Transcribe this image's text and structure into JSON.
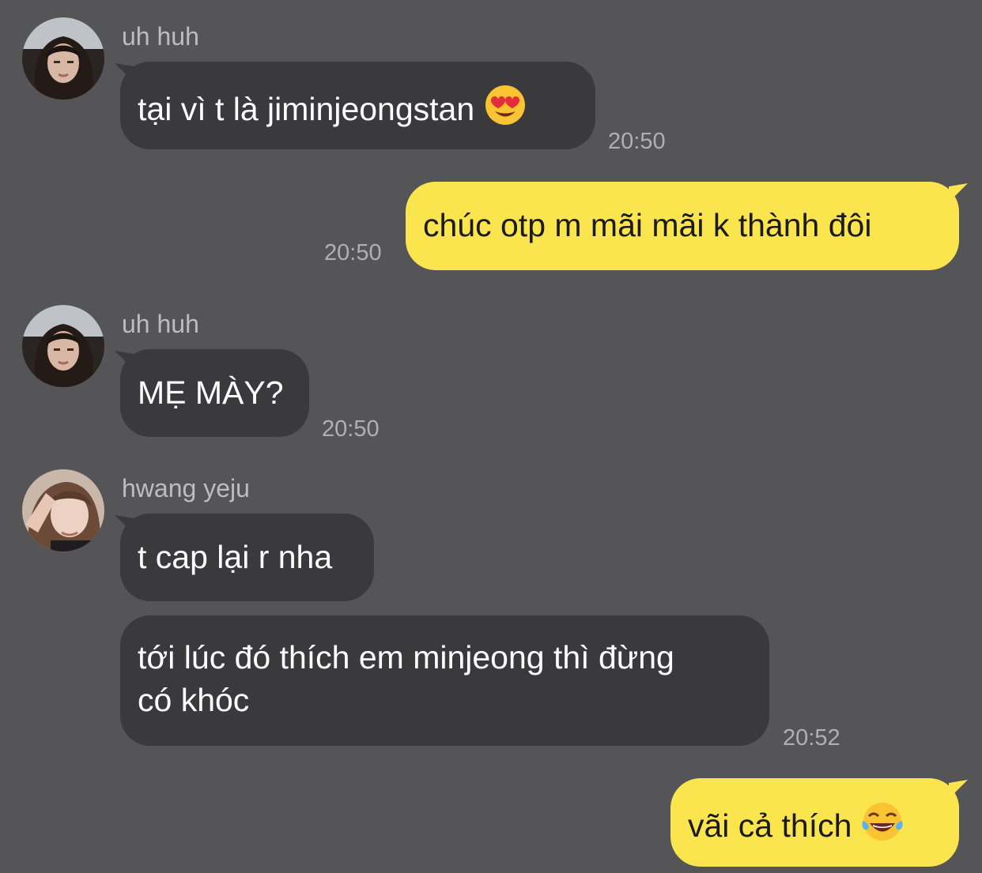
{
  "messages": [
    {
      "sender": "uh huh",
      "text": "tại vì t là jiminjeongstan",
      "emoji": "heart-eyes-emoji",
      "time": "20:50"
    },
    {
      "text": "chúc otp m mãi mãi k thành đôi",
      "time": "20:50"
    },
    {
      "sender": "uh huh",
      "text": "MẸ MÀY?",
      "time": "20:50"
    },
    {
      "sender": "hwang yeju",
      "text": "t cap lại r nha"
    },
    {
      "text_line1": "tới lúc đó thích em minjeong thì đừng",
      "text_line2": "có khóc",
      "time": "20:52"
    },
    {
      "text": "vãi cả thích",
      "emoji": "tears-of-joy-emoji",
      "time": ""
    }
  ],
  "colors": {
    "background": "#555456",
    "incoming_bubble": "#3a393c",
    "outgoing_bubble": "#fbe54e",
    "incoming_text": "#ffffff",
    "outgoing_text": "#1b1b1b",
    "meta_text": "#b0afb2"
  }
}
